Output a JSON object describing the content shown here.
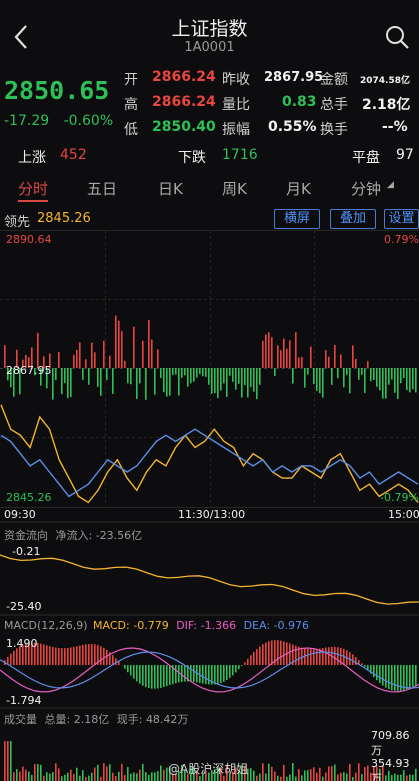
{
  "header": {
    "title": "上证指数",
    "code": "1A0001"
  },
  "quote": {
    "price": "2850.65",
    "change": "-17.29",
    "change_pct": "-0.60%",
    "open_label": "开",
    "open": "2866.24",
    "high_label": "高",
    "high": "2866.24",
    "low_label": "低",
    "low": "2850.40",
    "prev_close_label": "昨收",
    "prev_close": "2867.95",
    "volume_ratio_label": "量比",
    "volume_ratio": "0.83",
    "amplitude_label": "振幅",
    "amplitude": "0.55%",
    "amount_label": "金额",
    "amount": "2074.58亿",
    "total_hands_label": "总手",
    "total_hands": "2.18亿",
    "turnover_label": "换手",
    "turnover": "--%"
  },
  "breadth": {
    "up_label": "上涨",
    "up": "452",
    "down_label": "下跌",
    "down": "1716",
    "flat_label": "平盘",
    "flat": "97"
  },
  "tabs": [
    "分时",
    "五日",
    "日K",
    "周K",
    "月K",
    "分钟"
  ],
  "toolbar": {
    "lead_label": "领先",
    "lead_value": "2845.26",
    "buttons": [
      "横屏",
      "叠加",
      "设置"
    ]
  },
  "main_chart": {
    "top_left": "2890.64",
    "top_right": "0.79%",
    "mid_left": "2867.95",
    "bottom_left": "2845.26",
    "bottom_right": "-0.79%",
    "x_ticks": [
      "09:30",
      "11:30/13:00",
      "15:00"
    ]
  },
  "fund_flow": {
    "label": "资金流向",
    "net_label": "净流入:",
    "net_value": "-23.56亿",
    "top": "-0.21",
    "bottom": "-25.40"
  },
  "macd": {
    "params": "MACD(12,26,9)",
    "macd_label": "MACD:",
    "macd": "-0.779",
    "dif_label": "DIF:",
    "dif": "-1.366",
    "dea_label": "DEA:",
    "dea": "-0.976",
    "top": "1.490",
    "bottom": "-1.794"
  },
  "volume": {
    "label": "成交量",
    "total_label": "总量:",
    "total": "2.18亿",
    "now_label": "现手:",
    "now": "48.42万",
    "top": "709.86万",
    "mid": "354.93万"
  },
  "watermark": "@A股沪深胡姐",
  "colors": {
    "up": "#e8463f",
    "down": "#2fbf57",
    "line": "#f5b530",
    "index_line": "#5b8fe8",
    "accent": "#4f8ff5"
  },
  "chart_data": {
    "type": "line",
    "series": [
      {
        "name": "",
        "values": [
          2862,
          2858,
          2857,
          2855,
          2860,
          2858,
          2853,
          2850,
          2847,
          2846,
          2848,
          2851,
          2853,
          2850,
          2848,
          2851,
          2853,
          2852,
          2855,
          2857,
          2855,
          2856,
          2858,
          2856,
          2855,
          2852,
          2854,
          2853,
          2851,
          2850,
          2850,
          2852,
          2851,
          2850,
          2853,
          2854,
          2851,
          2848,
          2849,
          2847,
          2848,
          2849,
          2848,
          2846
        ]
      },
      {
        "name": "",
        "values": [
          2857,
          2856,
          2854,
          2852,
          2853,
          2851,
          2849,
          2847,
          2848,
          2849,
          2851,
          2853,
          2852,
          2851,
          2852,
          2854,
          2856,
          2857,
          2856,
          2857,
          2858,
          2857,
          2856,
          2855,
          2854,
          2853,
          2852,
          2853,
          2851,
          2852,
          2851,
          2852,
          2852,
          2851,
          2852,
          2853,
          2852,
          2850,
          2851,
          2849,
          2850,
          2851,
          2850,
          2849
        ]
      }
    ],
    "ylim": [
      2845.26,
      2890.64
    ]
  }
}
